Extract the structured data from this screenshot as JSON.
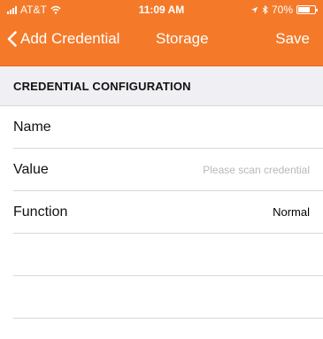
{
  "status_bar": {
    "carrier": "AT&T",
    "time": "11:09 AM",
    "battery": "70%",
    "battery_level": 0.7,
    "icons": [
      "signal-icon",
      "wifi-icon",
      "location-icon",
      "bluetooth-icon",
      "battery-icon"
    ]
  },
  "nav": {
    "back_label": "Add Credential",
    "title": "Storage",
    "save_label": "Save"
  },
  "section": {
    "header": "CREDENTIAL CONFIGURATION"
  },
  "fields": [
    {
      "label": "Name",
      "value": ""
    },
    {
      "label": "Value",
      "placeholder": "Please scan credential"
    },
    {
      "label": "Function",
      "value": "Normal"
    }
  ],
  "colors": {
    "accent": "#f47a2a",
    "section_bg": "#efeff4",
    "separator": "#d8d8dc",
    "placeholder": "#b8b8bd"
  }
}
